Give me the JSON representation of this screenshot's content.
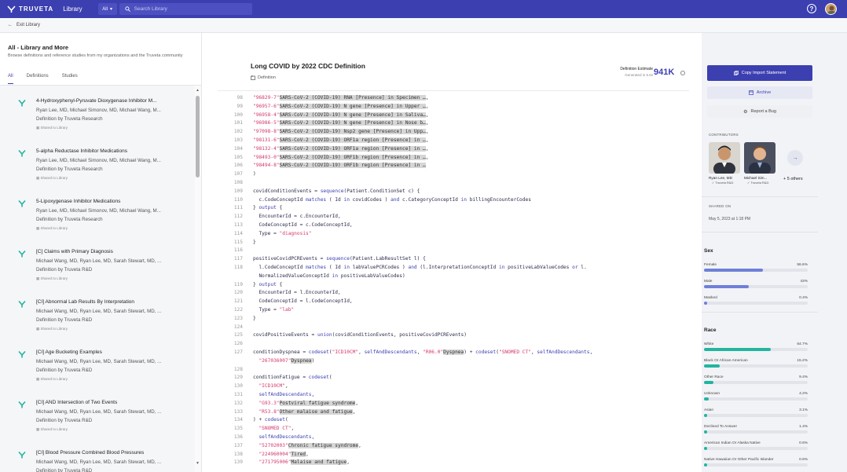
{
  "topbar": {
    "brand": "TRUVETA",
    "app": "Library",
    "scope": "All",
    "search_placeholder": "Search Library",
    "help": "?"
  },
  "subbar": {
    "back_label": "Exit Library"
  },
  "sidebar": {
    "title": "All - Library and More",
    "description": "Browse definitions and reference studies from my organizations and the Truveta community",
    "tabs": [
      "All",
      "Definitions",
      "Studies"
    ],
    "items": [
      {
        "name": "4-Hydroxyphenyl-Pyruvate Dioxygenase Inhibitor M...",
        "authors": "Ryan Lee, MD, Michael Simonov, MD, Michael Wang, M...",
        "org": "Definition by Truveta Research",
        "shared": "Shared to Library"
      },
      {
        "name": "5-alpha Reductase Inhibitor Medications",
        "authors": "Ryan Lee, MD, Michael Simonov, MD, Michael Wang, M...",
        "org": "Definition by Truveta Research",
        "shared": "Shared to Library"
      },
      {
        "name": "5-Lipoxygenase Inhibitor Medications",
        "authors": "Ryan Lee, MD, Michael Simonov, MD, Michael Wang, M...",
        "org": "Definition by Truveta Research",
        "shared": "Shared to Library"
      },
      {
        "name": "[C] Claims with Primary Diagnosis",
        "authors": "Michael Wang, MD, Ryan Lee, MD, Sarah Stewart, MD, ...",
        "org": "Definition by Truveta R&D",
        "shared": "Shared to Library"
      },
      {
        "name": "[CI] Abnormal Lab Results By Interpretation",
        "authors": "Michael Wang, MD, Ryan Lee, MD, Sarah Stewart, MD, ...",
        "org": "Definition by Truveta R&D",
        "shared": "Shared to Library"
      },
      {
        "name": "[CI] Age Bucketing Examples",
        "authors": "Michael Wang, MD, Ryan Lee, MD, Sarah Stewart, MD, ...",
        "org": "Definition by Truveta R&D",
        "shared": "Shared to Library"
      },
      {
        "name": "[CI] AND Intersection of Two Events",
        "authors": "Michael Wang, MD, Ryan Lee, MD, Sarah Stewart, MD, ...",
        "org": "Definition by Truveta R&D",
        "shared": "Shared to Library"
      },
      {
        "name": "[CI] Blood Pressure Combined Blood Pressures",
        "authors": "Michael Wang, MD, Ryan Lee, MD, Sarah Stewart, MD, ...",
        "org": "Definition by Truveta R&D",
        "shared": "Shared to Library"
      }
    ]
  },
  "main": {
    "title": "Long COVID by 2022 CDC Definition",
    "subtitle": "Definition",
    "estimate_label": "Definition Estimate",
    "estimate_generated": "Generated in 5.6s",
    "estimate_value": "941K",
    "code_lines": [
      {
        "n": "98",
        "t": [
          [
            "s",
            "\"96829-7\""
          ],
          [
            "h",
            "SARS-CoV-2 (COVID-19) RNA [Presence] in Specimen …"
          ],
          [
            "p",
            ","
          ]
        ]
      },
      {
        "n": "99",
        "t": [
          [
            "s",
            "\"96957-6\""
          ],
          [
            "h",
            "SARS-CoV-2 (COVID-19) N gene [Presence] in Upper …"
          ],
          [
            "p",
            ","
          ]
        ]
      },
      {
        "n": "100",
        "t": [
          [
            "s",
            "\"96958-4\""
          ],
          [
            "h",
            "SARS-CoV-2 (COVID-19) N gene [Presence] in Saliva…"
          ],
          [
            "p",
            ","
          ]
        ]
      },
      {
        "n": "101",
        "t": [
          [
            "s",
            "\"96986-5\""
          ],
          [
            "h",
            "SARS-CoV-2 (COVID-19) N gene [Presence] in Nose b…"
          ],
          [
            "p",
            ","
          ]
        ]
      },
      {
        "n": "102",
        "t": [
          [
            "s",
            "\"97098-8\""
          ],
          [
            "h",
            "SARS-CoV-2 (COVID-19) Nsp2 gene [Presence] in Upp…"
          ],
          [
            "p",
            ","
          ]
        ]
      },
      {
        "n": "103",
        "t": [
          [
            "s",
            "\"98131-6\""
          ],
          [
            "h",
            "SARS-CoV-2 (COVID-19) ORF1a region [Presence] in …"
          ],
          [
            "p",
            ","
          ]
        ]
      },
      {
        "n": "104",
        "t": [
          [
            "s",
            "\"98132-4\""
          ],
          [
            "h",
            "SARS-CoV-2 (COVID-19) ORF1a region [Presence] in …"
          ],
          [
            "p",
            ","
          ]
        ]
      },
      {
        "n": "105",
        "t": [
          [
            "s",
            "\"98493-0\""
          ],
          [
            "h",
            "SARS-CoV-2 (COVID-19) ORF1b region [Presence] in …"
          ],
          [
            "p",
            ","
          ]
        ]
      },
      {
        "n": "106",
        "t": [
          [
            "s",
            "\"98494-8\""
          ],
          [
            "h",
            "SARS-CoV-2 (COVID-19) ORF1b region [Presence] in …"
          ]
        ]
      },
      {
        "n": "107",
        "t": [
          [
            "p",
            ")"
          ]
        ]
      },
      {
        "n": "108",
        "t": []
      },
      {
        "n": "109",
        "t": [
          [
            "p",
            "covidConditionEvents = "
          ],
          [
            "k",
            "sequence"
          ],
          [
            "p",
            "(Patient.ConditionSet c) {"
          ]
        ]
      },
      {
        "n": "110",
        "t": [
          [
            "p",
            "  c.CodeConceptId "
          ],
          [
            "k",
            "matches"
          ],
          [
            "p",
            " ( Id "
          ],
          [
            "k",
            "in"
          ],
          [
            "p",
            " covidCodes ) "
          ],
          [
            "k",
            "and"
          ],
          [
            "p",
            " c.CategoryConceptId "
          ],
          [
            "k",
            "in"
          ],
          [
            "p",
            " billingEncounterCodes"
          ]
        ]
      },
      {
        "n": "111",
        "t": [
          [
            "p",
            "} "
          ],
          [
            "k",
            "output"
          ],
          [
            "p",
            " {"
          ]
        ]
      },
      {
        "n": "112",
        "t": [
          [
            "p",
            "  EncounterId = c.EncounterId,"
          ]
        ]
      },
      {
        "n": "113",
        "t": [
          [
            "p",
            "  CodeConceptId = c.CodeConceptId,"
          ]
        ]
      },
      {
        "n": "114",
        "t": [
          [
            "p",
            "  Type = "
          ],
          [
            "s",
            "\"diagnosis\""
          ]
        ]
      },
      {
        "n": "115",
        "t": [
          [
            "p",
            "}"
          ]
        ]
      },
      {
        "n": "116",
        "t": []
      },
      {
        "n": "117",
        "t": [
          [
            "p",
            "positiveCovidPCREvents = "
          ],
          [
            "k",
            "sequence"
          ],
          [
            "p",
            "(Patient.LabResultSet l) {"
          ]
        ]
      },
      {
        "n": "118",
        "t": [
          [
            "p",
            "  l.CodeConceptId "
          ],
          [
            "k",
            "matches"
          ],
          [
            "p",
            " ( Id "
          ],
          [
            "k",
            "in"
          ],
          [
            "p",
            " labValuePCRCodes ) "
          ],
          [
            "k",
            "and"
          ],
          [
            "p",
            " (l.InterpretationConceptId "
          ],
          [
            "k",
            "in"
          ],
          [
            "p",
            " positiveLabValueCodes "
          ],
          [
            "k",
            "or"
          ],
          [
            "p",
            " l."
          ]
        ]
      },
      {
        "n": "",
        "t": [
          [
            "p",
            "  NormalizedValueConceptId "
          ],
          [
            "k",
            "in"
          ],
          [
            "p",
            " positiveLabValueCodes)"
          ]
        ]
      },
      {
        "n": "119",
        "t": [
          [
            "p",
            "} "
          ],
          [
            "k",
            "output"
          ],
          [
            "p",
            " {"
          ]
        ]
      },
      {
        "n": "120",
        "t": [
          [
            "p",
            "  EncounterId = l.EncounterId,"
          ]
        ]
      },
      {
        "n": "121",
        "t": [
          [
            "p",
            "  CodeConceptId = l.CodeConceptId,"
          ]
        ]
      },
      {
        "n": "122",
        "t": [
          [
            "p",
            "  Type = "
          ],
          [
            "s",
            "\"lab\""
          ]
        ]
      },
      {
        "n": "123",
        "t": [
          [
            "p",
            "}"
          ]
        ]
      },
      {
        "n": "124",
        "t": []
      },
      {
        "n": "125",
        "t": [
          [
            "p",
            "covidPositiveEvents = "
          ],
          [
            "k",
            "union"
          ],
          [
            "p",
            "(covidConditionEvents, positiveCovidPCREvents)"
          ]
        ]
      },
      {
        "n": "126",
        "t": []
      },
      {
        "n": "127",
        "t": [
          [
            "p",
            "conditionDyspnea = "
          ],
          [
            "k",
            "codeset"
          ],
          [
            "p",
            "("
          ],
          [
            "s",
            "\"ICD10CM\""
          ],
          [
            "p",
            ", "
          ],
          [
            "k",
            "selfAndDescendants"
          ],
          [
            "p",
            ", "
          ],
          [
            "s",
            "\"R06.0\""
          ],
          [
            "h",
            "Dyspnea"
          ],
          [
            "p",
            ") + "
          ],
          [
            "k",
            "codeset"
          ],
          [
            "p",
            "("
          ],
          [
            "s",
            "\"SNOMED CT\""
          ],
          [
            "p",
            ", "
          ],
          [
            "k",
            "selfAndDescendants"
          ],
          [
            "p",
            ","
          ]
        ]
      },
      {
        "n": "",
        "t": [
          [
            "s",
            "  \"267036007\""
          ],
          [
            "h",
            "Dyspnea"
          ],
          [
            "p",
            ")"
          ]
        ]
      },
      {
        "n": "128",
        "t": []
      },
      {
        "n": "129",
        "t": [
          [
            "p",
            "conditionFatigue = "
          ],
          [
            "k",
            "codeset"
          ],
          [
            "p",
            "("
          ]
        ]
      },
      {
        "n": "130",
        "t": [
          [
            "s",
            "  \"ICD10CM\""
          ],
          [
            "p",
            ","
          ]
        ]
      },
      {
        "n": "131",
        "t": [
          [
            "k",
            "  selfAndDescendants"
          ],
          [
            "p",
            ","
          ]
        ]
      },
      {
        "n": "132",
        "t": [
          [
            "s",
            "  \"G93.3\""
          ],
          [
            "h",
            "Postviral fatigue syndrome"
          ],
          [
            "p",
            ","
          ]
        ]
      },
      {
        "n": "133",
        "t": [
          [
            "s",
            "  \"R53.8\""
          ],
          [
            "h",
            "Other malaise and fatigue"
          ],
          [
            "p",
            ","
          ]
        ]
      },
      {
        "n": "134",
        "t": [
          [
            "p",
            ") + "
          ],
          [
            "k",
            "codeset"
          ],
          [
            "p",
            "("
          ]
        ]
      },
      {
        "n": "135",
        "t": [
          [
            "s",
            "  \"SNOMED CT\""
          ],
          [
            "p",
            ","
          ]
        ]
      },
      {
        "n": "136",
        "t": [
          [
            "k",
            "  selfAndDescendants"
          ],
          [
            "p",
            ","
          ]
        ]
      },
      {
        "n": "137",
        "t": [
          [
            "s",
            "  \"52702003\""
          ],
          [
            "h",
            "Chronic fatigue syndrome"
          ],
          [
            "p",
            ","
          ]
        ]
      },
      {
        "n": "138",
        "t": [
          [
            "s",
            "  \"224960004\""
          ],
          [
            "h",
            "Tired"
          ],
          [
            "p",
            ","
          ]
        ]
      },
      {
        "n": "139",
        "t": [
          [
            "s",
            "  \"271795006\""
          ],
          [
            "h",
            "Malaise and fatigue"
          ],
          [
            "p",
            ","
          ]
        ]
      }
    ]
  },
  "right": {
    "copy_label": "Copy Import Statement",
    "archive_label": "Archive",
    "bug_label": "Report a Bug",
    "contributors_heading": "CONTRIBUTORS",
    "contributors": [
      {
        "name": "Ryan Lee, MD",
        "org": "Truveta R&D"
      },
      {
        "name": "Michael Sim...",
        "org": "Truveta R&D"
      }
    ],
    "more_label": "+ 5 others",
    "shared_heading": "SHARED ON",
    "shared_value": "May 5, 2023 at 1:18 PM",
    "sex_heading": "Sex",
    "sex": [
      {
        "label": "Female",
        "value": "56.6%",
        "pct": 56.6
      },
      {
        "label": "Male",
        "value": "43%",
        "pct": 43
      },
      {
        "label": "Masked",
        "value": "0.4%",
        "pct": 0.4
      }
    ],
    "race_heading": "Race",
    "race": [
      {
        "label": "White",
        "value": "64.7%",
        "pct": 64.7
      },
      {
        "label": "Black Or African American",
        "value": "15.2%",
        "pct": 15.2
      },
      {
        "label": "Other Race",
        "value": "9.4%",
        "pct": 9.4
      },
      {
        "label": "Unknown",
        "value": "4.2%",
        "pct": 4.2
      },
      {
        "label": "Asian",
        "value": "3.1%",
        "pct": 3.1
      },
      {
        "label": "Declined To Answer",
        "value": "1.4%",
        "pct": 1.4
      },
      {
        "label": "American Indian Or Alaska Native",
        "value": "0.6%",
        "pct": 0.6
      },
      {
        "label": "Native Hawaiian Or Other Pacific Islander",
        "value": "0.6%",
        "pct": 0.6
      }
    ],
    "colors": {
      "sex": "#6f80d9",
      "race": "#22b5a0"
    }
  }
}
